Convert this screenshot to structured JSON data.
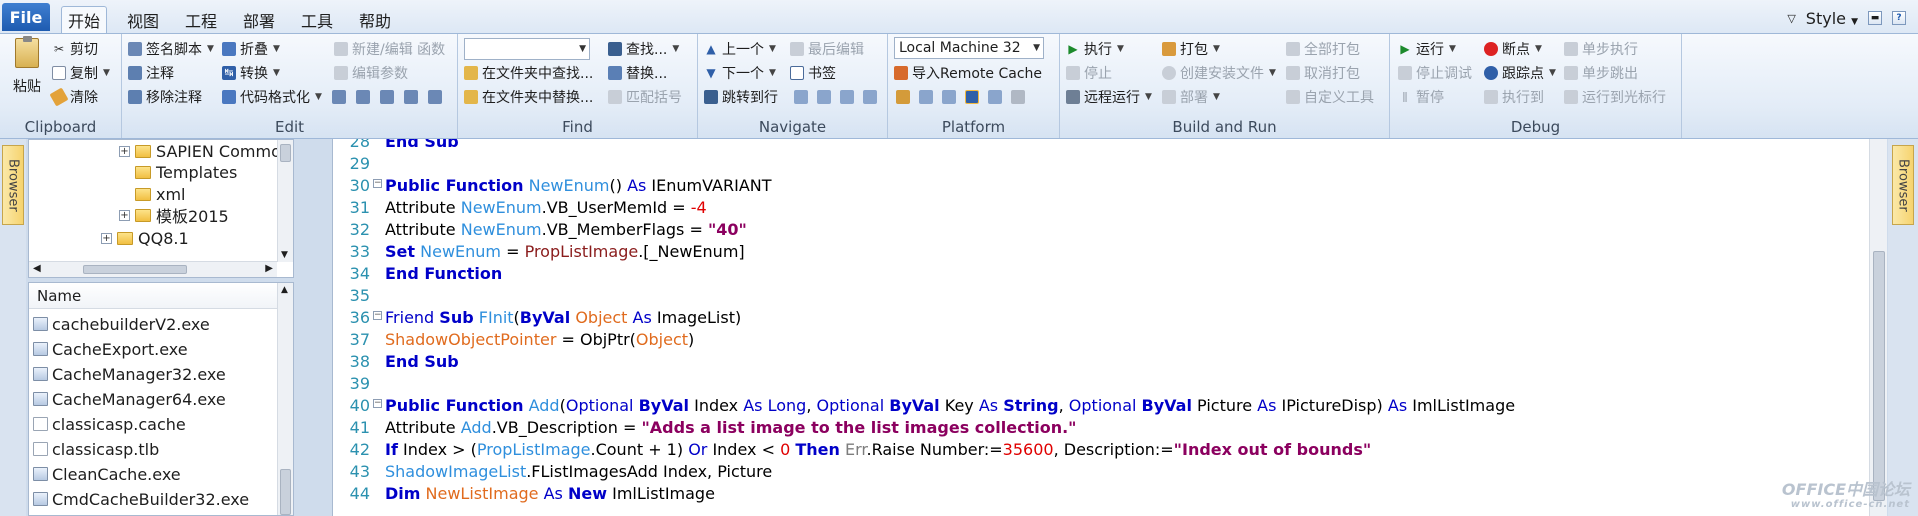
{
  "tabs": {
    "file": "File",
    "items": [
      "开始",
      "视图",
      "工程",
      "部署",
      "工具",
      "帮助"
    ],
    "active_index": 0
  },
  "style_menu": {
    "label": "Style"
  },
  "ribbon": {
    "clipboard": {
      "label": "Clipboard",
      "paste": "粘贴",
      "cut": "剪切",
      "copy": "复制",
      "clear": "清除"
    },
    "edit": {
      "label": "Edit",
      "signature": "签名脚本",
      "fold": "折叠",
      "new_edit_function": "新建/编辑 函数",
      "comment": "注释",
      "convert": "转换",
      "edit_params": "编辑参数",
      "remove_comment": "移除注释",
      "format_code": "代码格式化"
    },
    "find": {
      "label": "Find",
      "search_value": "",
      "find": "查找...",
      "find_in_files": "在文件夹中查找...",
      "replace": "替换...",
      "replace_in_files": "在文件夹中替换...",
      "match_brackets": "匹配括号"
    },
    "navigate": {
      "label": "Navigate",
      "prev": "上一个",
      "last_edit": "最后编辑",
      "next": "下一个",
      "bookmark": "书签",
      "goto_line": "跳转到行"
    },
    "platform": {
      "label": "Platform",
      "machine": "Local Machine 32",
      "import_cache": "导入Remote Cache"
    },
    "build_run": {
      "label": "Build and Run",
      "execute": "执行",
      "stop": "停止",
      "remote_run": "远程运行",
      "package": "打包",
      "create_installer": "创建安装文件",
      "deploy": "部署",
      "package_all": "全部打包",
      "cancel_package": "取消打包",
      "custom_tools": "自定义工具"
    },
    "debug": {
      "label": "Debug",
      "run": "运行",
      "stop_debug": "停止调试",
      "pause": "暂停",
      "breakpoint": "断点",
      "tracepoint": "跟踪点",
      "run_to": "执行到",
      "step_into": "单步执行",
      "step_over": "单步跳出",
      "run_to_cursor": "运行到光标行"
    }
  },
  "side_rails": {
    "left": "Browser",
    "right": "Browser"
  },
  "tree": {
    "items": [
      {
        "label": "SAPIEN Commo",
        "expandable": true
      },
      {
        "label": "Templates",
        "expandable": false
      },
      {
        "label": "xml",
        "expandable": false
      },
      {
        "label": "模板2015",
        "expandable": true
      },
      {
        "label": "QQ8.1",
        "expandable": true
      }
    ]
  },
  "files": {
    "header": "Name",
    "items": [
      {
        "name": "cachebuilderV2.exe",
        "icon": "exe-icon"
      },
      {
        "name": "CacheExport.exe",
        "icon": "exe-icon"
      },
      {
        "name": "CacheManager32.exe",
        "icon": "window-exe-icon"
      },
      {
        "name": "CacheManager64.exe",
        "icon": "window-exe-icon"
      },
      {
        "name": "classicasp.cache",
        "icon": "document-icon"
      },
      {
        "name": "classicasp.tlb",
        "icon": "document-icon"
      },
      {
        "name": "CleanCache.exe",
        "icon": "exe-icon"
      },
      {
        "name": "CmdCacheBuilder32.exe",
        "icon": "window-exe-icon"
      }
    ]
  },
  "code": {
    "lines": [
      {
        "n": "28",
        "fold": false,
        "segs": [
          [
            "kw",
            "End Sub"
          ]
        ]
      },
      {
        "n": "29",
        "fold": false,
        "segs": []
      },
      {
        "n": "30",
        "fold": true,
        "segs": [
          [
            "kw",
            "Public Function"
          ],
          [
            "",
            " "
          ],
          [
            "fn",
            "NewEnum"
          ],
          [
            "",
            "() "
          ],
          [
            "ty",
            "As"
          ],
          [
            "",
            " IEnumVARIANT"
          ]
        ]
      },
      {
        "n": "31",
        "fold": false,
        "segs": [
          [
            "",
            "Attribute "
          ],
          [
            "fn",
            "NewEnum"
          ],
          [
            "",
            ".VB_UserMemId = "
          ],
          [
            "nu",
            "-4"
          ]
        ]
      },
      {
        "n": "32",
        "fold": false,
        "segs": [
          [
            "",
            "Attribute "
          ],
          [
            "fn",
            "NewEnum"
          ],
          [
            "",
            ".VB_MemberFlags = "
          ],
          [
            "st",
            "\"40\""
          ]
        ]
      },
      {
        "n": "33",
        "fold": false,
        "segs": [
          [
            "kw",
            "Set"
          ],
          [
            "",
            " "
          ],
          [
            "fn",
            "NewEnum"
          ],
          [
            "",
            " = "
          ],
          [
            "pr",
            "PropListImage"
          ],
          [
            "",
            ".[_NewEnum]"
          ]
        ]
      },
      {
        "n": "34",
        "fold": false,
        "segs": [
          [
            "kw",
            "End Function"
          ]
        ]
      },
      {
        "n": "35",
        "fold": false,
        "segs": []
      },
      {
        "n": "36",
        "fold": true,
        "segs": [
          [
            "ty",
            "Friend"
          ],
          [
            "",
            " "
          ],
          [
            "kw",
            "Sub"
          ],
          [
            "",
            " "
          ],
          [
            "fn",
            "FInit"
          ],
          [
            "",
            "("
          ],
          [
            "kw",
            "ByVal"
          ],
          [
            "",
            " "
          ],
          [
            "sv",
            "Object"
          ],
          [
            "",
            " "
          ],
          [
            "ty",
            "As"
          ],
          [
            "",
            " ImageList)"
          ]
        ]
      },
      {
        "n": "37",
        "fold": false,
        "segs": [
          [
            "sv",
            "ShadowObjectPointer"
          ],
          [
            "",
            " = ObjPtr("
          ],
          [
            "sv",
            "Object"
          ],
          [
            "",
            ")"
          ]
        ]
      },
      {
        "n": "38",
        "fold": false,
        "segs": [
          [
            "kw",
            "End Sub"
          ]
        ]
      },
      {
        "n": "39",
        "fold": false,
        "segs": []
      },
      {
        "n": "40",
        "fold": true,
        "segs": [
          [
            "kw",
            "Public Function"
          ],
          [
            "",
            " "
          ],
          [
            "fn",
            "Add"
          ],
          [
            "",
            "("
          ],
          [
            "ty",
            "Optional"
          ],
          [
            "",
            " "
          ],
          [
            "kw",
            "ByVal"
          ],
          [
            "",
            " Index "
          ],
          [
            "ty",
            "As Long"
          ],
          [
            "",
            ", "
          ],
          [
            "ty",
            "Optional"
          ],
          [
            "",
            " "
          ],
          [
            "kw",
            "ByVal"
          ],
          [
            "",
            " Key "
          ],
          [
            "ty",
            "As"
          ],
          [
            "",
            " "
          ],
          [
            "kw",
            "String"
          ],
          [
            "",
            ", "
          ],
          [
            "ty",
            "Optional"
          ],
          [
            "",
            " "
          ],
          [
            "kw",
            "ByVal"
          ],
          [
            "",
            " Picture "
          ],
          [
            "ty",
            "As"
          ],
          [
            "",
            " IPictureDisp) "
          ],
          [
            "ty",
            "As"
          ],
          [
            "",
            " ImlListImage"
          ]
        ]
      },
      {
        "n": "41",
        "fold": false,
        "segs": [
          [
            "",
            "Attribute "
          ],
          [
            "fn",
            "Add"
          ],
          [
            "",
            ".VB_Description = "
          ],
          [
            "st",
            "\"Adds a list image to the list images collection.\""
          ]
        ]
      },
      {
        "n": "42",
        "fold": false,
        "segs": [
          [
            "kw",
            "If"
          ],
          [
            "",
            " Index > ("
          ],
          [
            "fn",
            "PropListImage"
          ],
          [
            "",
            ".Count + 1) "
          ],
          [
            "ty",
            "Or"
          ],
          [
            "",
            " Index < "
          ],
          [
            "nu",
            "0"
          ],
          [
            "",
            " "
          ],
          [
            "kw",
            "Then"
          ],
          [
            "",
            " "
          ],
          [
            "er",
            "Err"
          ],
          [
            "",
            ".Raise Number:="
          ],
          [
            "nu",
            "35600"
          ],
          [
            "",
            ", Description:="
          ],
          [
            "st",
            "\"Index out of bounds\""
          ]
        ]
      },
      {
        "n": "43",
        "fold": false,
        "segs": [
          [
            "fn",
            "ShadowImageList"
          ],
          [
            "",
            ".FListImagesAdd Index, Picture"
          ]
        ]
      },
      {
        "n": "44",
        "fold": false,
        "segs": [
          [
            "kw",
            "Dim"
          ],
          [
            "",
            " "
          ],
          [
            "sv",
            "NewListImage"
          ],
          [
            "",
            " "
          ],
          [
            "ty",
            "As"
          ],
          [
            "",
            " "
          ],
          [
            "kw",
            "New"
          ],
          [
            "",
            " ImlListImage"
          ]
        ]
      }
    ]
  },
  "watermark": {
    "line1": "OFFICE中国论坛",
    "line2": "www.office-cn.net"
  }
}
